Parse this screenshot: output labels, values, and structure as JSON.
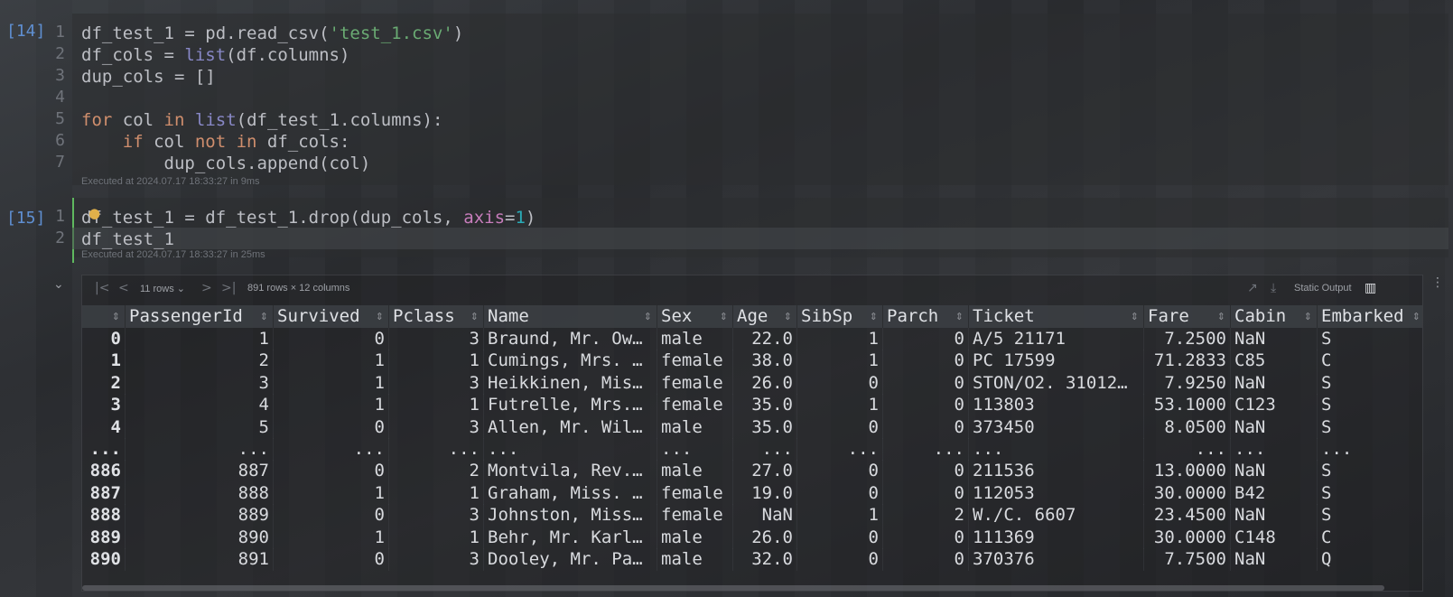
{
  "cells": [
    {
      "exec_count": "[14]",
      "line_numbers": [
        "1",
        "2",
        "3",
        "4",
        "5",
        "6",
        "7"
      ],
      "exec_info": "Executed at 2024.07.17 18:33:27 in 9ms"
    },
    {
      "exec_count": "[15]",
      "line_numbers": [
        "1",
        "2"
      ],
      "exec_info": "Executed at 2024.07.17 18:33:27 in 25ms"
    }
  ],
  "code14": {
    "l1a": "df_test_1 = pd.read_csv(",
    "l1b": "'test_1.csv'",
    "l1c": ")",
    "l2a": "df_cols = ",
    "l2b": "list",
    "l2c": "(df.columns)",
    "l3": "dup_cols = []",
    "l5a": "for",
    "l5b": " col ",
    "l5c": "in",
    "l5d": " ",
    "l5e": "list",
    "l5f": "(df_test_1.columns):",
    "l6a": "    if",
    "l6b": " col ",
    "l6c": "not in",
    "l6d": " df_cols:",
    "l7": "        dup_cols.append(col)"
  },
  "code15": {
    "l1a": "df_test_1 = df_test_1.drop(dup_cols, ",
    "l1b": "axis",
    "l1c": "=",
    "l1d": "1",
    "l1e": ")",
    "l2": "df_test_1"
  },
  "output_toolbar": {
    "rows_selector": "11 rows",
    "chevron": "⌄",
    "shape": "891 rows × 12 columns",
    "static_output": "Static Output"
  },
  "table": {
    "headers": [
      "",
      "PassengerId",
      "Survived",
      "Pclass",
      "Name",
      "Sex",
      "Age",
      "SibSp",
      "Parch",
      "Ticket",
      "Fare",
      "Cabin",
      "Embarked"
    ],
    "rows": [
      [
        "0",
        "1",
        "0",
        "3",
        "Braund, Mr. Ow…",
        "male",
        "22.0",
        "1",
        "0",
        "A/5 21171",
        "7.2500",
        "NaN",
        "S"
      ],
      [
        "1",
        "2",
        "1",
        "1",
        "Cumings, Mrs. …",
        "female",
        "38.0",
        "1",
        "0",
        "PC 17599",
        "71.2833",
        "C85",
        "C"
      ],
      [
        "2",
        "3",
        "1",
        "3",
        "Heikkinen, Mis…",
        "female",
        "26.0",
        "0",
        "0",
        "STON/O2. 31012…",
        "7.9250",
        "NaN",
        "S"
      ],
      [
        "3",
        "4",
        "1",
        "1",
        "Futrelle, Mrs.…",
        "female",
        "35.0",
        "1",
        "0",
        "113803",
        "53.1000",
        "C123",
        "S"
      ],
      [
        "4",
        "5",
        "0",
        "3",
        "Allen, Mr. Wil…",
        "male",
        "35.0",
        "0",
        "0",
        "373450",
        "8.0500",
        "NaN",
        "S"
      ],
      [
        "...",
        "...",
        "...",
        "...",
        "...",
        "...",
        "...",
        "...",
        "...",
        "...",
        "...",
        "...",
        "..."
      ],
      [
        "886",
        "887",
        "0",
        "2",
        "Montvila, Rev.…",
        "male",
        "27.0",
        "0",
        "0",
        "211536",
        "13.0000",
        "NaN",
        "S"
      ],
      [
        "887",
        "888",
        "1",
        "1",
        "Graham, Miss. …",
        "female",
        "19.0",
        "0",
        "0",
        "112053",
        "30.0000",
        "B42",
        "S"
      ],
      [
        "888",
        "889",
        "0",
        "3",
        "Johnston, Miss…",
        "female",
        "NaN",
        "1",
        "2",
        "W./C. 6607",
        "23.4500",
        "NaN",
        "S"
      ],
      [
        "889",
        "890",
        "1",
        "1",
        "Behr, Mr. Karl…",
        "male",
        "26.0",
        "0",
        "0",
        "111369",
        "30.0000",
        "C148",
        "C"
      ],
      [
        "890",
        "891",
        "0",
        "3",
        "Dooley, Mr. Pa…",
        "male",
        "32.0",
        "0",
        "0",
        "370376",
        "7.7500",
        "NaN",
        "Q"
      ]
    ]
  }
}
